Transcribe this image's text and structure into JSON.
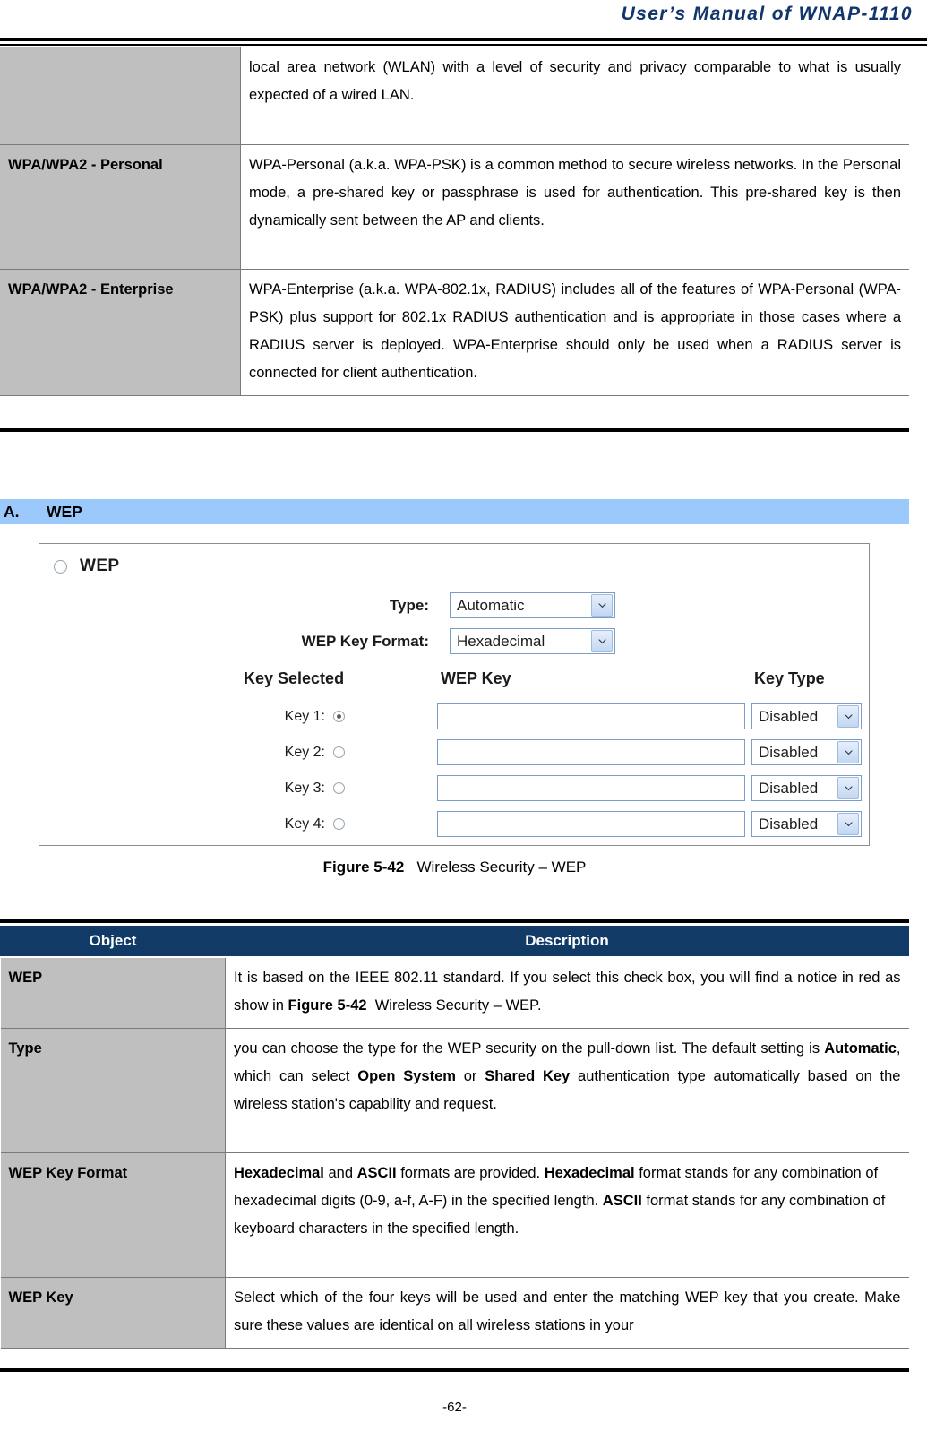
{
  "header": {
    "title": "User’s Manual of WNAP-1110"
  },
  "colors": {
    "brand_navy": "#12356b",
    "table_header_navy": "#113a66",
    "section_banner_blue": "#9cc9fb",
    "object_cell_gray": "#bfbfbf"
  },
  "table_top": {
    "rows": [
      {
        "object": "",
        "description": "local area network (WLAN) with a level of security and privacy comparable to what is usually expected of a wired LAN."
      },
      {
        "object": "WPA/WPA2 - Personal",
        "description": "WPA-Personal (a.k.a. WPA-PSK) is a common method to secure wireless networks. In the Personal mode, a pre-shared key or passphrase is used for authentication. This pre-shared key is then dynamically sent between the AP and clients."
      },
      {
        "object": "WPA/WPA2 - Enterprise",
        "description": "WPA-Enterprise (a.k.a. WPA-802.1x, RADIUS) includes all of the features of WPA-Personal (WPA-PSK) plus support for 802.1x RADIUS authentication and is appropriate in those cases where a RADIUS server is deployed. WPA-Enterprise should only be used when a RADIUS server is connected for client authentication."
      }
    ]
  },
  "section": {
    "letter": "A.",
    "title": "WEP"
  },
  "wep_screenshot": {
    "enabled_label": "WEP",
    "enabled_checked": false,
    "type": {
      "label": "Type:",
      "value": "Automatic"
    },
    "key_format": {
      "label": "WEP Key Format:",
      "value": "Hexadecimal"
    },
    "columns": {
      "key_selected": "Key Selected",
      "wep_key": "WEP Key",
      "key_type": "Key Type"
    },
    "keys": [
      {
        "label": "Key 1:",
        "selected": true,
        "value": "",
        "key_type": "Disabled"
      },
      {
        "label": "Key 2:",
        "selected": false,
        "value": "",
        "key_type": "Disabled"
      },
      {
        "label": "Key 3:",
        "selected": false,
        "value": "",
        "key_type": "Disabled"
      },
      {
        "label": "Key 4:",
        "selected": false,
        "value": "",
        "key_type": "Disabled"
      }
    ]
  },
  "figure": {
    "number": "Figure 5-42",
    "caption": "Wireless Security – WEP"
  },
  "table_bottom": {
    "headers": {
      "object": "Object",
      "description": "Description"
    },
    "rows": [
      {
        "object": "WEP",
        "description_html": "It is based on the IEEE 802.11 standard. If you select this check box, you will find a notice in red as show in <b>Figure 5-42</b>&nbsp;&nbsp;Wireless Security – WEP.",
        "description_text": "It is based on the IEEE 802.11 standard. If you select this check box, you will find a notice in red as show in Figure 5-42  Wireless Security – WEP."
      },
      {
        "object": "Type",
        "description_html": "you can choose the type for the WEP security on the pull-down list. The default setting is <b>Automatic</b>, which can select <b>Open System</b> or <b>Shared Key</b> authentication type automatically based on the wireless station's capability and request.",
        "description_text": "you can choose the type for the WEP security on the pull-down list. The default setting is Automatic, which can select Open System or Shared Key authentication type automatically based on the wireless station's capability and request."
      },
      {
        "object": "WEP Key Format",
        "description_html": "<b>Hexadecimal</b> and <b>ASCII</b> formats are provided. <b>Hexadecimal</b> format stands for any combination of hexadecimal digits (0-9, a-f, A-F) in the specified length. <b>ASCII</b> format stands for any combination of keyboard characters in the specified length.",
        "description_text": "Hexadecimal and ASCII formats are provided. Hexadecimal format stands for any combination of hexadecimal digits (0-9, a-f, A-F) in the specified length. ASCII format stands for any combination of keyboard characters in the specified length."
      },
      {
        "object": "WEP Key",
        "description_html": "Select which of the four keys will be used and enter the matching WEP key that you create. Make sure these values are identical on all wireless stations in your",
        "description_text": "Select which of the four keys will be used and enter the matching WEP key that you create. Make sure these values are identical on all wireless stations in your"
      }
    ]
  },
  "footer": {
    "page_number": "-62-"
  }
}
